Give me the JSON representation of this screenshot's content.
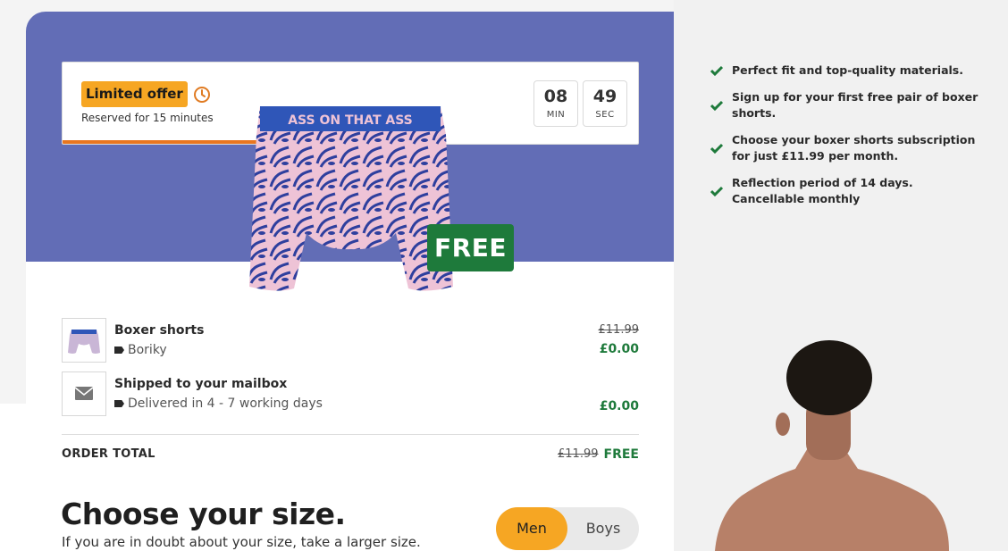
{
  "offer": {
    "badge_label": "Limited offer",
    "reserved_text": "Reserved for 15 minutes",
    "timer": {
      "minutes": "08",
      "minutes_unit": "MIN",
      "seconds": "49",
      "seconds_unit": "SEC"
    }
  },
  "product": {
    "waistband_text": "ASS ON THAT ASS",
    "free_badge": "FREE"
  },
  "order": {
    "items": [
      {
        "title": "Boxer shorts",
        "subtitle": "Boriky",
        "old_price": "£11.99",
        "price": "£0.00"
      },
      {
        "title": "Shipped to your mailbox",
        "subtitle": "Delivered in 4 - 7 working days",
        "price": "£0.00"
      }
    ],
    "total_label": "ORDER TOTAL",
    "total_old": "£11.99",
    "total_new": "FREE"
  },
  "size": {
    "title": "Choose your size.",
    "hint": "If you are in doubt about your size, take a larger size.",
    "options": [
      "Men",
      "Boys"
    ],
    "selected": "Men"
  },
  "benefits": [
    "Perfect fit and top-quality materials.",
    "Sign up for your first free pair of boxer shorts.",
    "Choose your boxer shorts subscription for just £11.99 per month.",
    "Reflection period of 14 days. Cancellable monthly"
  ],
  "colors": {
    "hero": "#626db6",
    "accent_orange": "#f6a623",
    "green": "#1e7a3b"
  }
}
